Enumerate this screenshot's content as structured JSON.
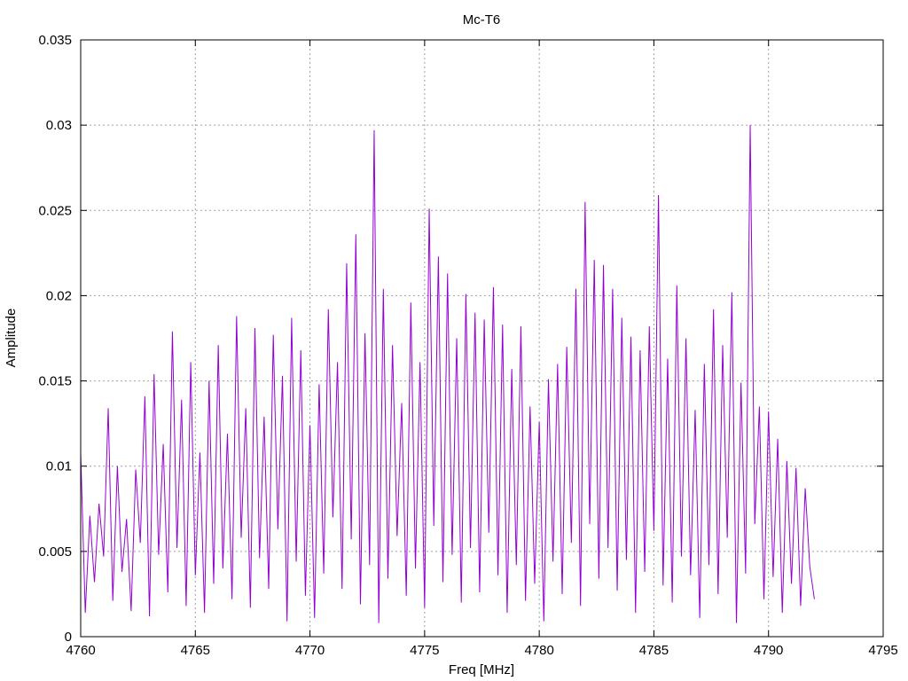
{
  "chart_data": {
    "type": "line",
    "title": "Mc-T6",
    "xlabel": "Freq [MHz]",
    "ylabel": "Amplitude",
    "xlim": [
      4760,
      4795
    ],
    "ylim": [
      0,
      0.035
    ],
    "xticks": [
      "4760",
      "4765",
      "4770",
      "4775",
      "4780",
      "4785",
      "4790",
      "4795"
    ],
    "yticks": [
      "0",
      "0.005",
      "0.01",
      "0.015",
      "0.02",
      "0.025",
      "0.03",
      "0.035"
    ],
    "grid": true,
    "series": [
      {
        "color": "#9400d3",
        "x": [
          4760.0,
          4760.2,
          4760.4,
          4760.6,
          4760.8,
          4761.0,
          4761.2,
          4761.4,
          4761.6,
          4761.8,
          4762.0,
          4762.2,
          4762.4,
          4762.6,
          4762.8,
          4763.0,
          4763.2,
          4763.4,
          4763.6,
          4763.8,
          4764.0,
          4764.2,
          4764.4,
          4764.6,
          4764.8,
          4765.0,
          4765.2,
          4765.4,
          4765.6,
          4765.8,
          4766.0,
          4766.2,
          4766.4,
          4766.6,
          4766.8,
          4767.0,
          4767.2,
          4767.4,
          4767.6,
          4767.8,
          4768.0,
          4768.2,
          4768.4,
          4768.6,
          4768.8,
          4769.0,
          4769.2,
          4769.4,
          4769.6,
          4769.8,
          4770.0,
          4770.2,
          4770.4,
          4770.6,
          4770.8,
          4771.0,
          4771.2,
          4771.4,
          4771.6,
          4771.8,
          4772.0,
          4772.2,
          4772.4,
          4772.6,
          4772.8,
          4773.0,
          4773.2,
          4773.4,
          4773.6,
          4773.8,
          4774.0,
          4774.2,
          4774.4,
          4774.6,
          4774.8,
          4775.0,
          4775.2,
          4775.4,
          4775.6,
          4775.8,
          4776.0,
          4776.2,
          4776.4,
          4776.6,
          4776.8,
          4777.0,
          4777.2,
          4777.4,
          4777.6,
          4777.8,
          4778.0,
          4778.2,
          4778.4,
          4778.6,
          4778.8,
          4779.0,
          4779.2,
          4779.4,
          4779.6,
          4779.8,
          4780.0,
          4780.2,
          4780.4,
          4780.6,
          4780.8,
          4781.0,
          4781.2,
          4781.4,
          4781.6,
          4781.8,
          4782.0,
          4782.2,
          4782.4,
          4782.6,
          4782.8,
          4783.0,
          4783.2,
          4783.4,
          4783.6,
          4783.8,
          4784.0,
          4784.2,
          4784.4,
          4784.6,
          4784.8,
          4785.0,
          4785.2,
          4785.4,
          4785.6,
          4785.8,
          4786.0,
          4786.2,
          4786.4,
          4786.6,
          4786.8,
          4787.0,
          4787.2,
          4787.4,
          4787.6,
          4787.8,
          4788.0,
          4788.2,
          4788.4,
          4788.6,
          4788.8,
          4789.0,
          4789.2,
          4789.4,
          4789.6,
          4789.8,
          4790.0,
          4790.2,
          4790.4,
          4790.6,
          4790.8,
          4791.0,
          4791.2,
          4791.4,
          4791.6,
          4791.8,
          4792.0
        ],
        "y": [
          0.0108,
          0.0014,
          0.0071,
          0.0032,
          0.0078,
          0.0047,
          0.0134,
          0.0021,
          0.01,
          0.0038,
          0.0069,
          0.0015,
          0.0098,
          0.0055,
          0.0141,
          0.0012,
          0.0154,
          0.0048,
          0.0113,
          0.0026,
          0.0179,
          0.0052,
          0.0139,
          0.0018,
          0.0161,
          0.0036,
          0.0108,
          0.0014,
          0.015,
          0.0031,
          0.0171,
          0.004,
          0.0119,
          0.0022,
          0.0188,
          0.0058,
          0.0134,
          0.0017,
          0.0181,
          0.0046,
          0.0129,
          0.0028,
          0.0177,
          0.0063,
          0.0153,
          0.0009,
          0.0187,
          0.0044,
          0.0168,
          0.0024,
          0.0124,
          0.0011,
          0.0148,
          0.0037,
          0.0192,
          0.007,
          0.0161,
          0.0028,
          0.0219,
          0.0057,
          0.0236,
          0.0019,
          0.0178,
          0.0042,
          0.0297,
          0.0008,
          0.0204,
          0.0034,
          0.0171,
          0.0059,
          0.0137,
          0.0024,
          0.0196,
          0.004,
          0.0161,
          0.0017,
          0.0251,
          0.0065,
          0.0223,
          0.0032,
          0.0213,
          0.0048,
          0.0175,
          0.002,
          0.0201,
          0.0052,
          0.019,
          0.0026,
          0.0186,
          0.0061,
          0.0205,
          0.0036,
          0.0183,
          0.0014,
          0.0157,
          0.0042,
          0.0182,
          0.0021,
          0.0135,
          0.0031,
          0.0126,
          0.0009,
          0.0151,
          0.0044,
          0.016,
          0.0025,
          0.017,
          0.0055,
          0.0204,
          0.0018,
          0.0255,
          0.0066,
          0.0221,
          0.0034,
          0.0218,
          0.0052,
          0.0204,
          0.0027,
          0.0187,
          0.0045,
          0.0176,
          0.0014,
          0.0168,
          0.0038,
          0.0182,
          0.0062,
          0.0259,
          0.003,
          0.0163,
          0.002,
          0.0206,
          0.0047,
          0.0175,
          0.0036,
          0.0133,
          0.0011,
          0.016,
          0.0042,
          0.0192,
          0.0025,
          0.0171,
          0.0058,
          0.0202,
          0.0008,
          0.0149,
          0.0037,
          0.03,
          0.0066,
          0.0135,
          0.0022,
          0.0132,
          0.0035,
          0.0116,
          0.0014,
          0.0103,
          0.0031,
          0.0099,
          0.0018,
          0.0087,
          0.0041,
          0.0022
        ]
      }
    ]
  }
}
